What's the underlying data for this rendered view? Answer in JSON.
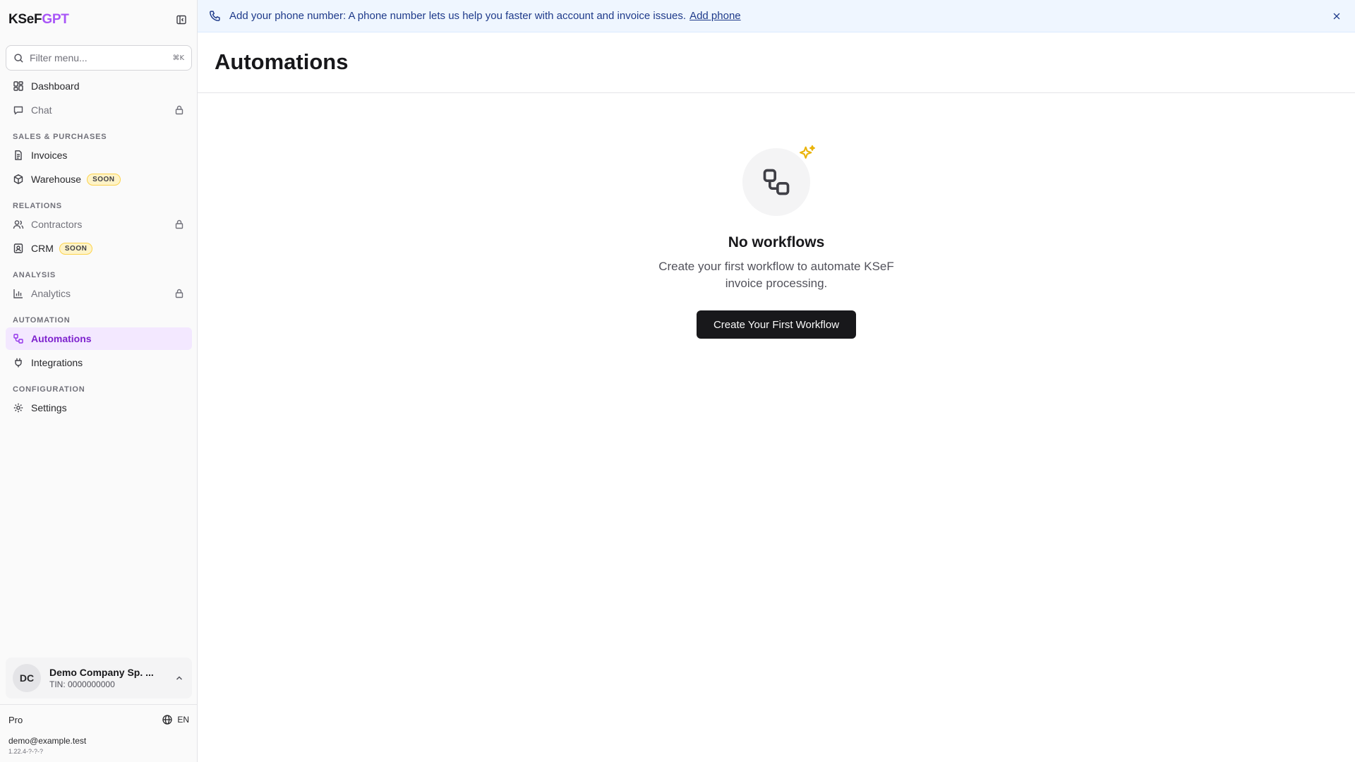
{
  "brand": {
    "part1": "KSeF",
    "part2": "GPT"
  },
  "search": {
    "placeholder": "Filter menu...",
    "shortcut": "⌘K"
  },
  "sidebar": {
    "top_items": [
      {
        "label": "Dashboard",
        "icon": "dashboard-icon"
      },
      {
        "label": "Chat",
        "icon": "chat-icon",
        "locked": true
      }
    ],
    "sections": [
      {
        "label": "SALES & PURCHASES",
        "items": [
          {
            "label": "Invoices"
          },
          {
            "label": "Warehouse",
            "badge": "SOON"
          }
        ]
      },
      {
        "label": "RELATIONS",
        "items": [
          {
            "label": "Contractors",
            "locked": true
          },
          {
            "label": "CRM",
            "badge": "SOON"
          }
        ]
      },
      {
        "label": "ANALYSIS",
        "items": [
          {
            "label": "Analytics",
            "locked": true
          }
        ]
      },
      {
        "label": "AUTOMATION",
        "items": [
          {
            "label": "Automations",
            "active": true
          },
          {
            "label": "Integrations"
          }
        ]
      },
      {
        "label": "CONFIGURATION",
        "items": [
          {
            "label": "Settings"
          }
        ]
      }
    ]
  },
  "account": {
    "initials": "DC",
    "name": "Demo Company Sp. ...",
    "tin": "TIN: 0000000000"
  },
  "footer": {
    "plan": "Pro",
    "language": "EN",
    "email": "demo@example.test",
    "version": "1.22.4-?-?-?"
  },
  "banner": {
    "text": "Add your phone number: A phone number lets us help you faster with account and invoice issues.",
    "link": "Add phone"
  },
  "page": {
    "title": "Automations"
  },
  "empty_state": {
    "title": "No workflows",
    "description": "Create your first workflow to automate KSeF invoice processing.",
    "button": "Create Your First Workflow"
  },
  "colors": {
    "accent": "#a855f7",
    "active_bg": "#f3e8ff",
    "active_text": "#7e22ce",
    "banner_bg": "#eff6ff",
    "sparkle": "#eab308",
    "button_bg": "#18181b"
  }
}
